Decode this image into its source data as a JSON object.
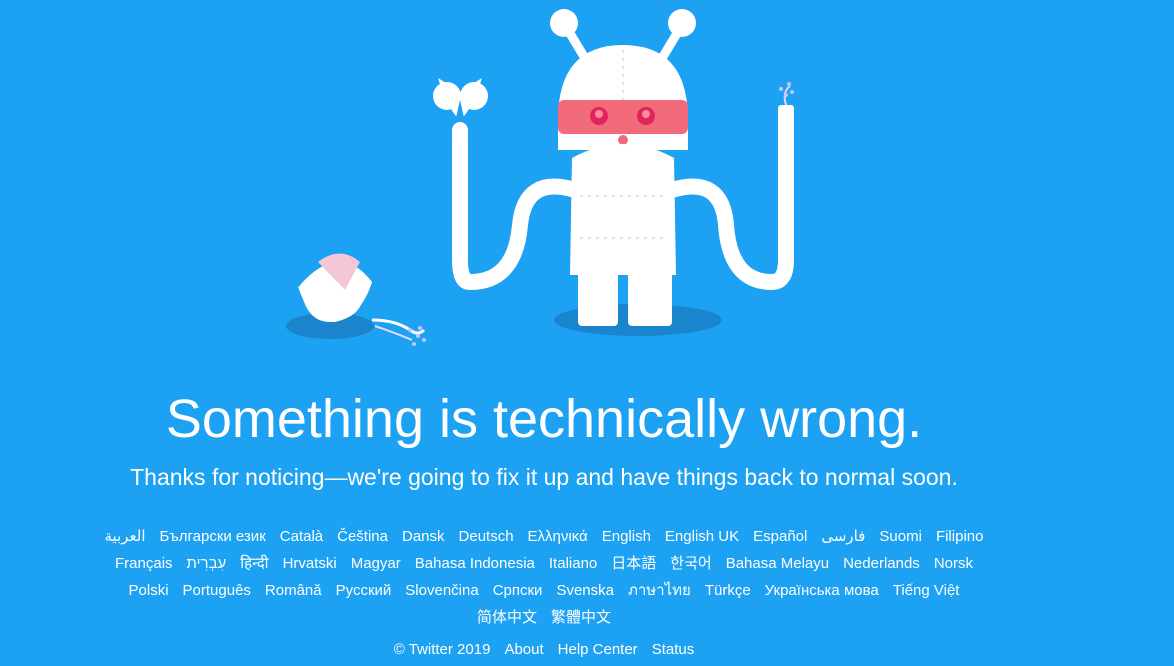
{
  "page": {
    "headline": "Something is technically wrong.",
    "subline": "Thanks for noticing—we're going to fix it up and have things back to normal soon."
  },
  "languages": [
    [
      "العربية",
      "Български език",
      "Català",
      "Čeština",
      "Dansk",
      "Deutsch",
      "Ελληνικά",
      "English",
      "English UK",
      "Español",
      "فارسی",
      "Suomi",
      "Filipino"
    ],
    [
      "Français",
      "עִבְרִית",
      "हिन्दी",
      "Hrvatski",
      "Magyar",
      "Bahasa Indonesia",
      "Italiano",
      "日本語",
      "한국어",
      "Bahasa Melayu",
      "Nederlands",
      "Norsk"
    ],
    [
      "Polski",
      "Português",
      "Română",
      "Русский",
      "Slovenčina",
      "Српски",
      "Svenska",
      "ภาษาไทย",
      "Türkçe",
      "Українська мова",
      "Tiếng Việt"
    ],
    [
      "简体中文",
      "繁體中文"
    ]
  ],
  "footer": {
    "copyright": "© Twitter 2019",
    "links": [
      "About",
      "Help Center",
      "Status"
    ]
  },
  "colors": {
    "background": "#1da1f2",
    "robot_body": "#ffffff",
    "robot_visor": "#e0245e",
    "shadow": "#1a7fc2"
  },
  "illustration": {
    "icon": "broken-robot-illustration"
  }
}
